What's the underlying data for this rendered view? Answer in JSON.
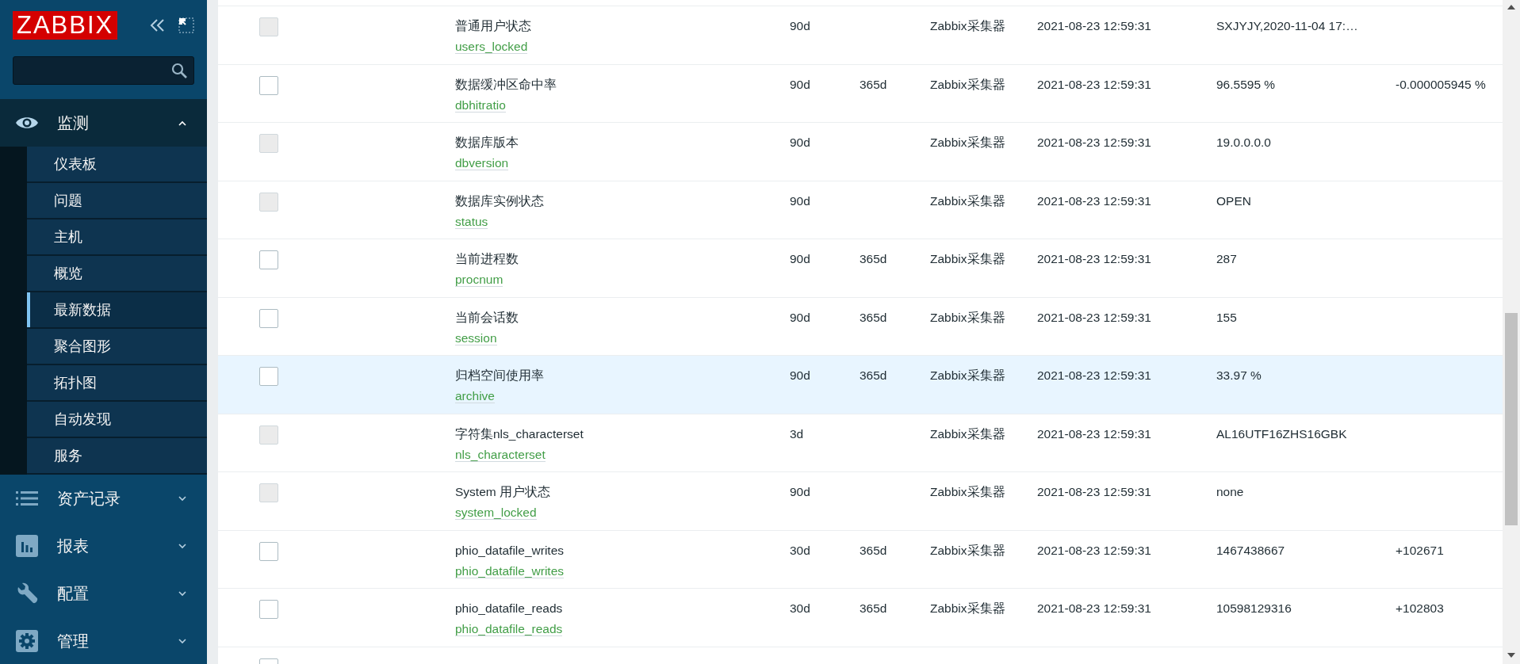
{
  "sidebar": {
    "logo": "ZABBIX",
    "sections": [
      {
        "label": "监测",
        "expanded": true,
        "items": [
          {
            "label": "仪表板",
            "selected": false
          },
          {
            "label": "问题",
            "selected": false
          },
          {
            "label": "主机",
            "selected": false
          },
          {
            "label": "概览",
            "selected": false
          },
          {
            "label": "最新数据",
            "selected": true
          },
          {
            "label": "聚合图形",
            "selected": false
          },
          {
            "label": "拓扑图",
            "selected": false
          },
          {
            "label": "自动发现",
            "selected": false
          },
          {
            "label": "服务",
            "selected": false
          }
        ]
      },
      {
        "label": "资产记录",
        "expanded": false
      },
      {
        "label": "报表",
        "expanded": false
      },
      {
        "label": "配置",
        "expanded": false
      },
      {
        "label": "管理",
        "expanded": false
      }
    ]
  },
  "table": {
    "rows": [
      {
        "disabled": true,
        "highlighted": false,
        "name": "普通用户状态",
        "key": "users_locked",
        "history": "90d",
        "type": "Zabbix采集器",
        "time": "2021-08-23 12:59:31",
        "value": "SXJYJY,2020-11-04 17:…"
      },
      {
        "disabled": false,
        "highlighted": false,
        "name": "数据缓冲区命中率",
        "key": "dbhitratio",
        "history": "90d",
        "trends": "365d",
        "type": "Zabbix采集器",
        "time": "2021-08-23 12:59:31",
        "value": "96.5595 %",
        "change": "-0.000005945 %"
      },
      {
        "disabled": true,
        "highlighted": false,
        "name": "数据库版本",
        "key": "dbversion",
        "history": "90d",
        "type": "Zabbix采集器",
        "time": "2021-08-23 12:59:31",
        "value": "19.0.0.0.0"
      },
      {
        "disabled": true,
        "highlighted": false,
        "name": "数据库实例状态",
        "key": "status",
        "history": "90d",
        "type": "Zabbix采集器",
        "time": "2021-08-23 12:59:31",
        "value": "OPEN"
      },
      {
        "disabled": false,
        "highlighted": false,
        "name": "当前进程数",
        "key": "procnum",
        "history": "90d",
        "trends": "365d",
        "type": "Zabbix采集器",
        "time": "2021-08-23 12:59:31",
        "value": "287"
      },
      {
        "disabled": false,
        "highlighted": false,
        "name": "当前会话数",
        "key": "session",
        "history": "90d",
        "trends": "365d",
        "type": "Zabbix采集器",
        "time": "2021-08-23 12:59:31",
        "value": "155"
      },
      {
        "disabled": false,
        "highlighted": true,
        "name": "归档空间使用率",
        "key": "archive",
        "history": "90d",
        "trends": "365d",
        "type": "Zabbix采集器",
        "time": "2021-08-23 12:59:31",
        "value": "33.97 %"
      },
      {
        "disabled": true,
        "highlighted": false,
        "name": "字符集nls_characterset",
        "key": "nls_characterset",
        "history": "3d",
        "type": "Zabbix采集器",
        "time": "2021-08-23 12:59:31",
        "value": "AL16UTF16ZHS16GBK"
      },
      {
        "disabled": true,
        "highlighted": false,
        "name": "System 用户状态",
        "key": "system_locked",
        "history": "90d",
        "type": "Zabbix采集器",
        "time": "2021-08-23 12:59:31",
        "value": "none"
      },
      {
        "disabled": false,
        "highlighted": false,
        "name": "phio_datafile_writes",
        "key": "phio_datafile_writes",
        "history": "30d",
        "trends": "365d",
        "type": "Zabbix采集器",
        "time": "2021-08-23 12:59:31",
        "value": "1467438667",
        "change": "+102671"
      },
      {
        "disabled": false,
        "highlighted": false,
        "name": "phio_datafile_reads",
        "key": "phio_datafile_reads",
        "history": "30d",
        "trends": "365d",
        "type": "Zabbix采集器",
        "time": "2021-08-23 12:59:31",
        "value": "10598129316",
        "change": "+102803"
      },
      {
        "disabled": false,
        "highlighted": false
      }
    ]
  }
}
